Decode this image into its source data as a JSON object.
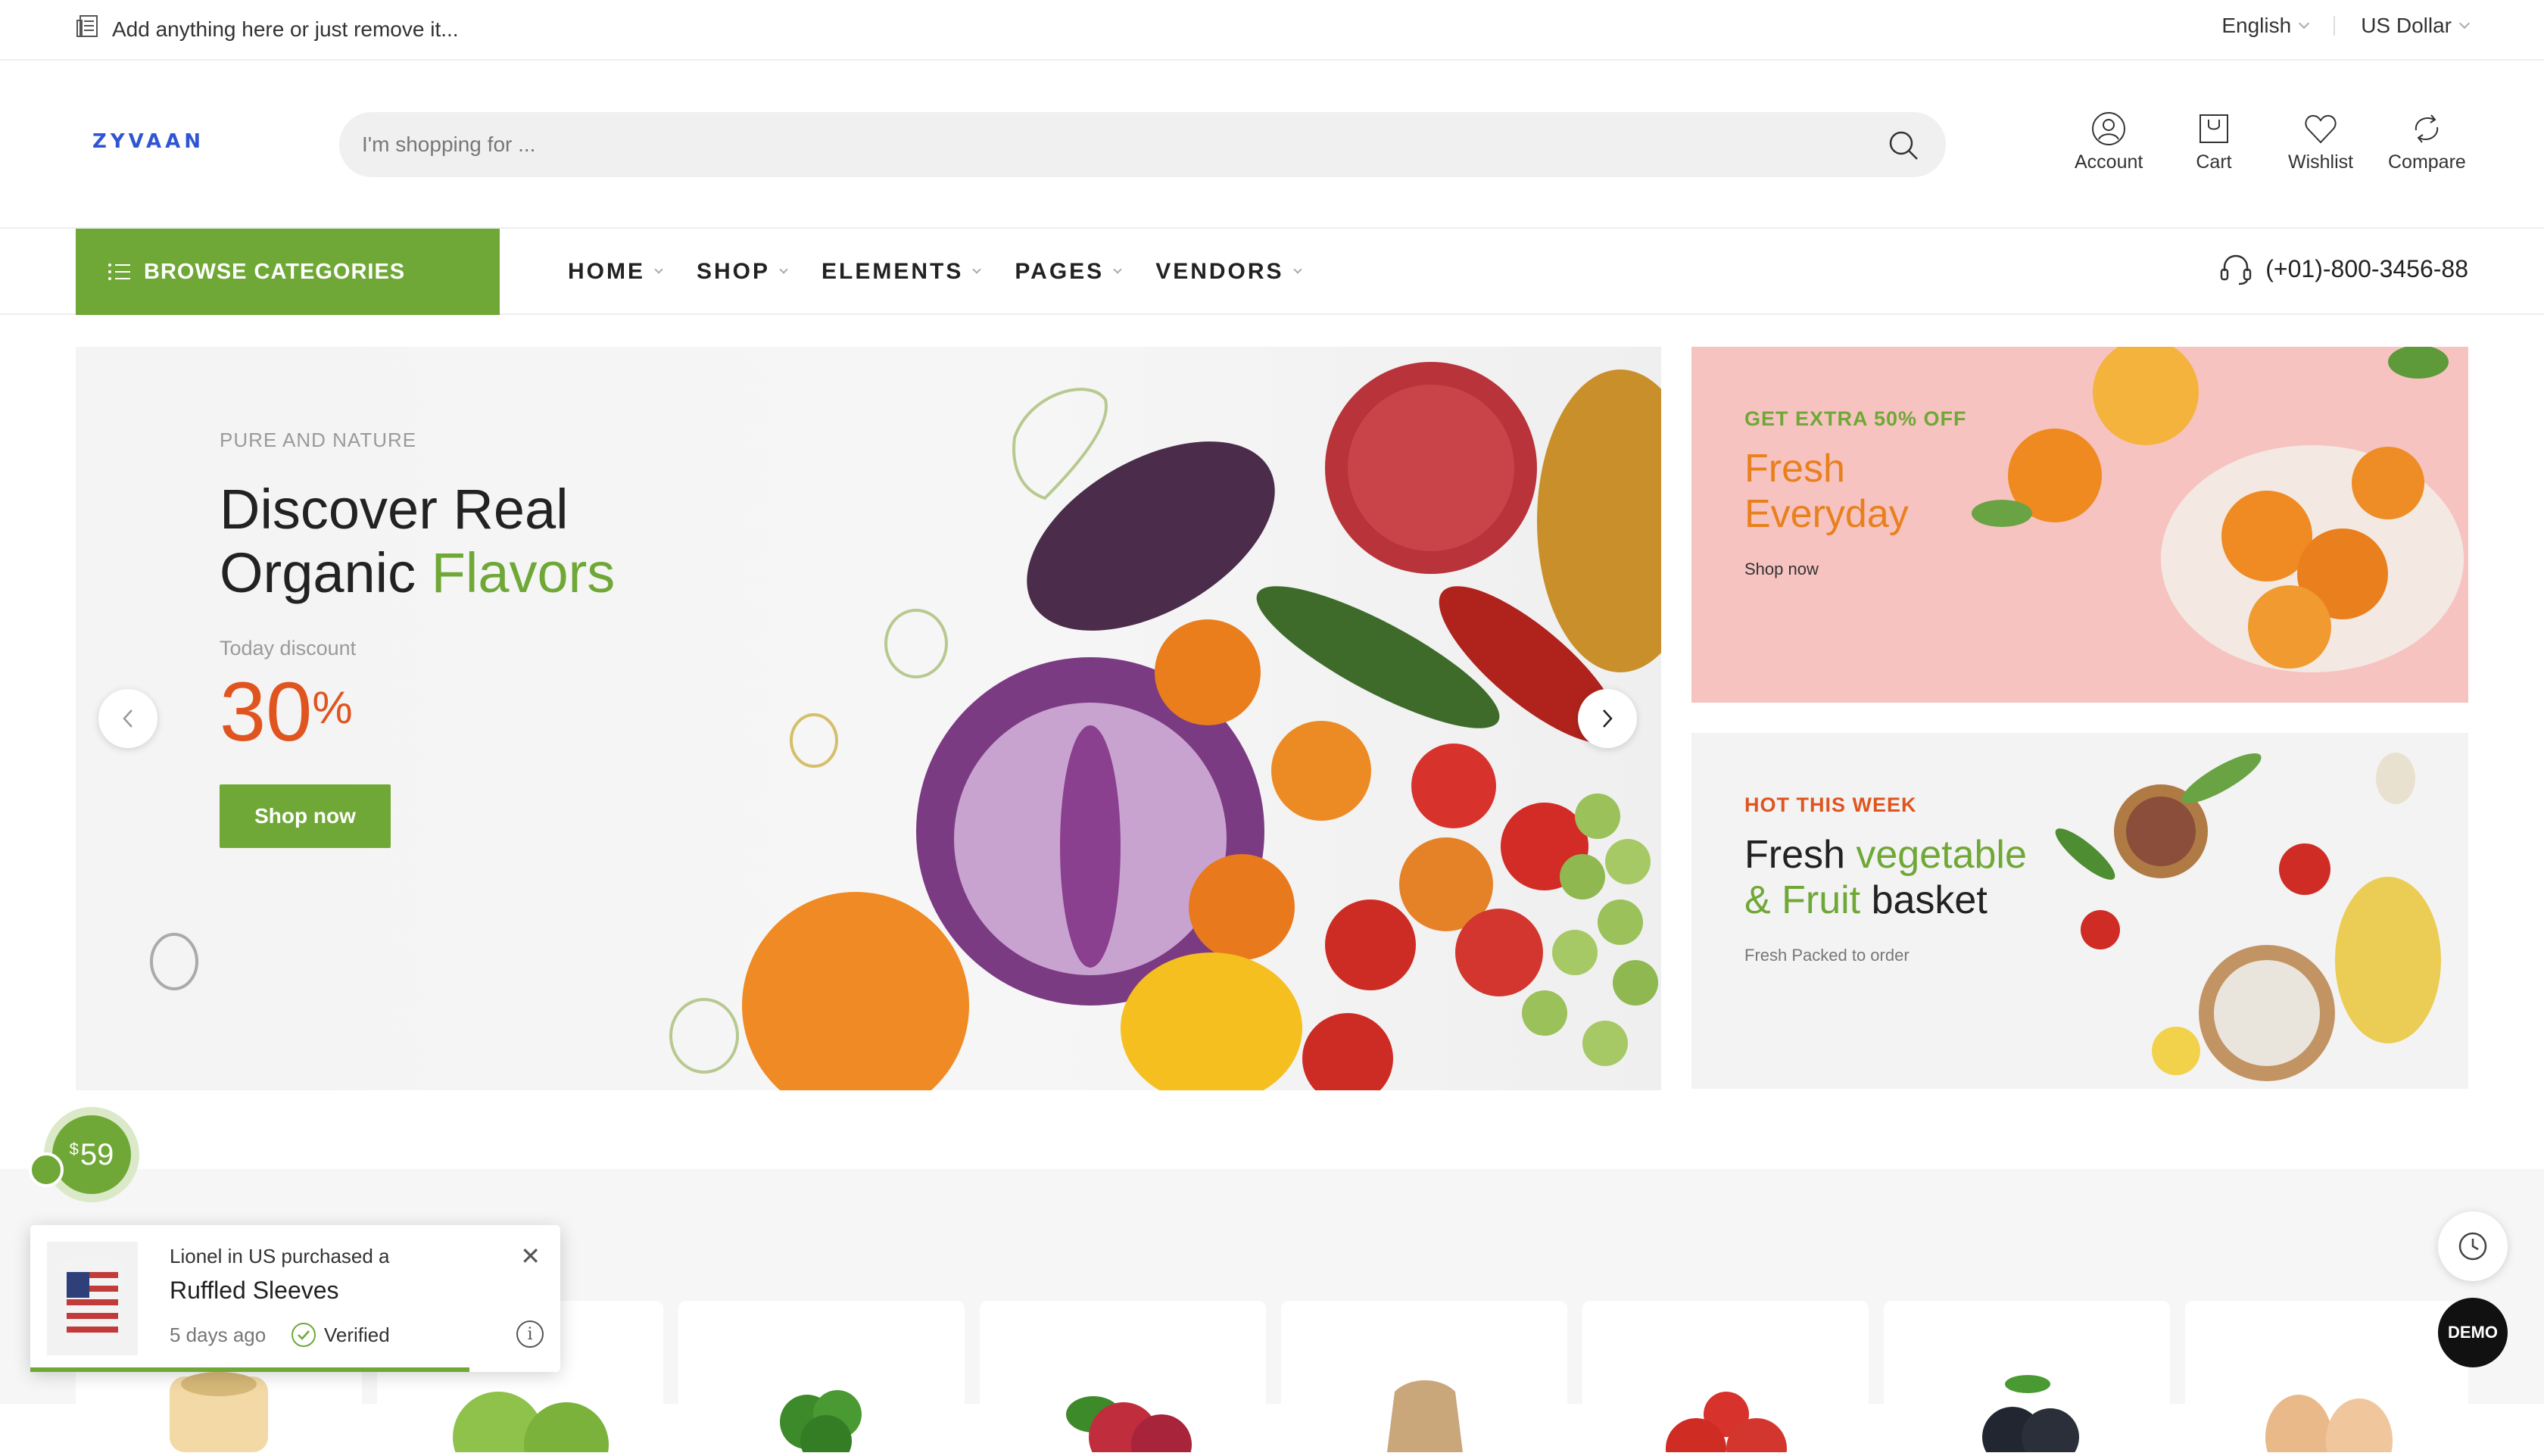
{
  "topbar": {
    "announcement": "Add anything here or just remove it...",
    "language": "English",
    "currency": "US Dollar"
  },
  "header": {
    "logo": "ZYVAAN",
    "search_placeholder": "I'm shopping for ...",
    "icons": [
      {
        "label": "Account",
        "icon": "user-icon"
      },
      {
        "label": "Cart",
        "icon": "cart-icon"
      },
      {
        "label": "Wishlist",
        "icon": "heart-icon"
      },
      {
        "label": "Compare",
        "icon": "compare-icon"
      }
    ]
  },
  "nav": {
    "browse_label": "BROWSE CATEGORIES",
    "items": [
      "HOME",
      "SHOP",
      "ELEMENTS",
      "PAGES",
      "VENDORS"
    ],
    "phone": "(+01)-800-3456-88"
  },
  "hero": {
    "eyebrow": "PURE AND NATURE",
    "title_line1": "Discover Real",
    "title_line2_plain": "Organic",
    "title_line2_accent": "Flavors",
    "discount_label": "Today discount",
    "discount_value": "30",
    "discount_unit": "%",
    "button": "Shop now"
  },
  "banners": [
    {
      "eyebrow": "GET EXTRA 50% OFF",
      "title_line1": "Fresh",
      "title_line2": "Everyday",
      "link": "Shop now"
    },
    {
      "eyebrow": "HOT THIS WEEK",
      "title_l1_plain": "Fresh",
      "title_l1_accent": "vegetable",
      "title_l2_accent": "& Fruit",
      "title_l2_plain": "basket",
      "link": "Fresh Packed to order"
    }
  ],
  "widgets": {
    "price_currency": "$",
    "price_value": "59",
    "popup_message": "Lionel in US purchased a",
    "popup_product": "Ruffled Sleeves",
    "popup_time": "5 days ago",
    "popup_verified": "Verified",
    "demo_label": "DEMO"
  },
  "colors": {
    "brand_green": "#6fa836",
    "discount_orange": "#e0551f",
    "logo_blue": "#2f55d4",
    "banner_pink": "#f7c3c0"
  }
}
